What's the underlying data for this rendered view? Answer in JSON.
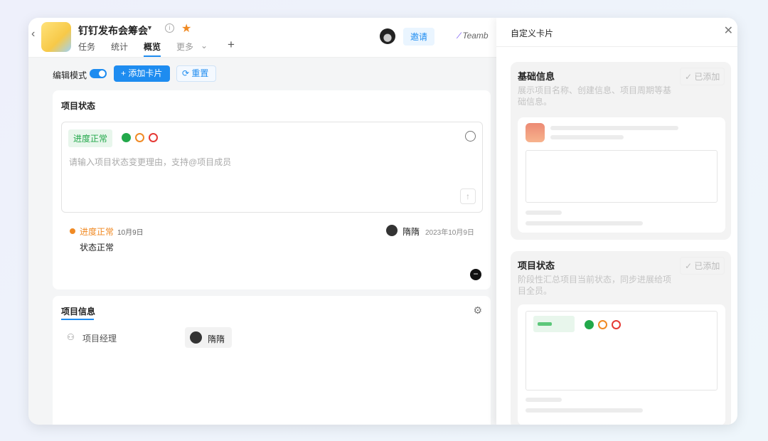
{
  "header": {
    "title": "钉钉发布会筹会",
    "tabs": [
      "任务",
      "统计",
      "概览",
      "更多"
    ],
    "invite": "邀请",
    "teambition": "Teamb"
  },
  "toolbar": {
    "edit_mode": "编辑模式",
    "add_card": "添加卡片",
    "reset": "重置"
  },
  "status_card": {
    "title": "项目状态",
    "badge": "进度正常",
    "placeholder": "请输入项目状态变更理由，支持@项目成员",
    "log_status": "进度正常",
    "log_date": "10月9日",
    "log_user": "隋隋",
    "log_time": "2023年10月9日",
    "log_text": "状态正常"
  },
  "info_card": {
    "title": "项目信息",
    "manager_label": "项目经理",
    "manager_name": "隋隋"
  },
  "panel": {
    "title": "自定义卡片",
    "cards": [
      {
        "title": "基础信息",
        "desc": "展示项目名称、创建信息、项目周期等基础信息。",
        "added": "已添加"
      },
      {
        "title": "项目状态",
        "desc": "阶段性汇总项目当前状态，同步进展给项目全员。",
        "added": "已添加"
      }
    ]
  },
  "colors": {
    "accent": "#1e8cf0",
    "green": "#22a84a",
    "orange": "#f08a24",
    "red": "#e53935"
  }
}
